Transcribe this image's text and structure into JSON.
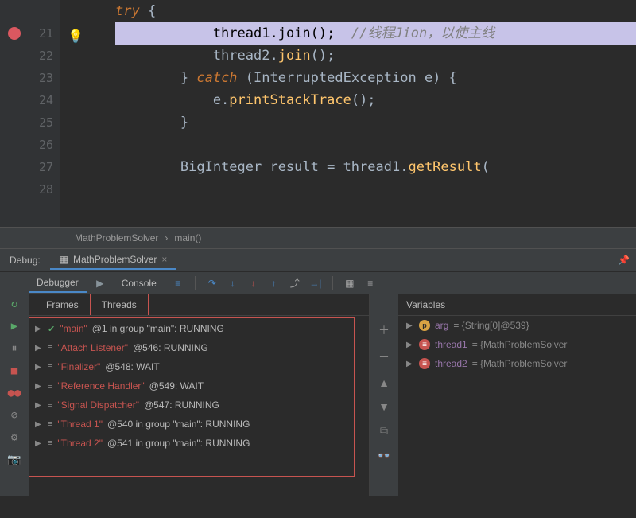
{
  "lines": [
    "21",
    "22",
    "23",
    "24",
    "25",
    "26",
    "27",
    "28"
  ],
  "code": {
    "l0_kw": "try",
    "l0_brace": " {",
    "l1_pre": "            thread1.",
    "l1_mtd": "join",
    "l1_post": "();  ",
    "l1_cm": "//线程Jion，以使主线",
    "l2_pre": "            thread2.",
    "l2_mtd": "join",
    "l2_post": "();",
    "l3_pre": "        } ",
    "l3_kw": "catch",
    "l3_post": " (InterruptedException e) {",
    "l4_pre": "            e.",
    "l4_mtd": "printStackTrace",
    "l4_post": "();",
    "l5": "        }",
    "l7_pre": "        BigInteger result = thread1.",
    "l7_mtd": "getResult",
    "l7_post": "("
  },
  "breadcrumb": {
    "class": "MathProblemSolver",
    "method": "main()"
  },
  "debug": {
    "label": "Debug:",
    "file": "MathProblemSolver"
  },
  "debuggerTabs": {
    "debugger": "Debugger",
    "console": "Console"
  },
  "innerTabs": {
    "frames": "Frames",
    "threads": "Threads"
  },
  "threads": [
    {
      "tick": true,
      "name": "\"main\"",
      "rest": "@1 in group \"main\": RUNNING"
    },
    {
      "tick": false,
      "name": "\"Attach Listener\"",
      "rest": "@546: RUNNING"
    },
    {
      "tick": false,
      "name": "\"Finalizer\"",
      "rest": "@548: WAIT"
    },
    {
      "tick": false,
      "name": "\"Reference Handler\"",
      "rest": "@549: WAIT"
    },
    {
      "tick": false,
      "name": "\"Signal Dispatcher\"",
      "rest": "@547: RUNNING"
    },
    {
      "tick": false,
      "name": "\"Thread 1\"",
      "rest": "@540 in group \"main\": RUNNING"
    },
    {
      "tick": false,
      "name": "\"Thread 2\"",
      "rest": "@541 in group \"main\": RUNNING"
    }
  ],
  "varsHeader": "Variables",
  "vars": [
    {
      "badge": "p",
      "name": "arg",
      "val": " = {String[0]@539}"
    },
    {
      "badge": "f",
      "name": "thread1",
      "val": " = {MathProblemSolver"
    },
    {
      "badge": "f",
      "name": "thread2",
      "val": " = {MathProblemSolver"
    }
  ]
}
